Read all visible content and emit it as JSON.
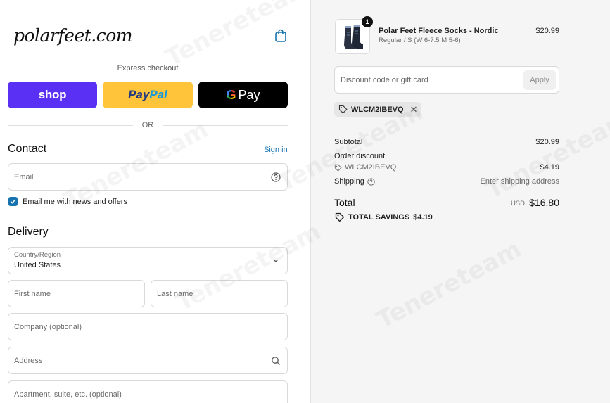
{
  "header": {
    "logo_text": "polarfeet.com",
    "cart_icon": "shopping-bag-icon"
  },
  "express": {
    "label": "Express checkout",
    "shop_label": "shop",
    "paypal_part1": "Pay",
    "paypal_part2": "Pal",
    "gpay_g": "G",
    "gpay_label": "Pay",
    "or_label": "OR"
  },
  "contact": {
    "heading": "Contact",
    "sign_in": "Sign in",
    "email_placeholder": "Email",
    "newsletter_label": "Email me with news and offers",
    "newsletter_checked": true
  },
  "delivery": {
    "heading": "Delivery",
    "country_label": "Country/Region",
    "country_value": "United States",
    "first_name_placeholder": "First name",
    "last_name_placeholder": "Last name",
    "company_placeholder": "Company (optional)",
    "address_placeholder": "Address",
    "apartment_placeholder": "Apartment, suite, etc. (optional)"
  },
  "order": {
    "product_name": "Polar Feet Fleece Socks - Nordic",
    "product_variant": "Regular / S (W 6-7.5 M 5-6)",
    "product_price": "$20.99",
    "quantity": "1",
    "discount_placeholder": "Discount code or gift card",
    "apply_label": "Apply",
    "applied_code": "WLCM2IBEVQ",
    "subtotal_label": "Subtotal",
    "subtotal_value": "$20.99",
    "order_discount_label": "Order discount",
    "order_discount_code": "WLCM2IBEVQ",
    "order_discount_value": "− $4.19",
    "shipping_label": "Shipping",
    "shipping_value": "Enter shipping address",
    "total_label": "Total",
    "currency": "USD",
    "total_value": "$16.80",
    "savings_label": "TOTAL SAVINGS",
    "savings_value": "$4.19"
  },
  "colors": {
    "accent": "#1773b0",
    "shop": "#5a31f4",
    "paypal": "#ffc439",
    "gpay": "#000000"
  },
  "watermark": "Tenereteam"
}
